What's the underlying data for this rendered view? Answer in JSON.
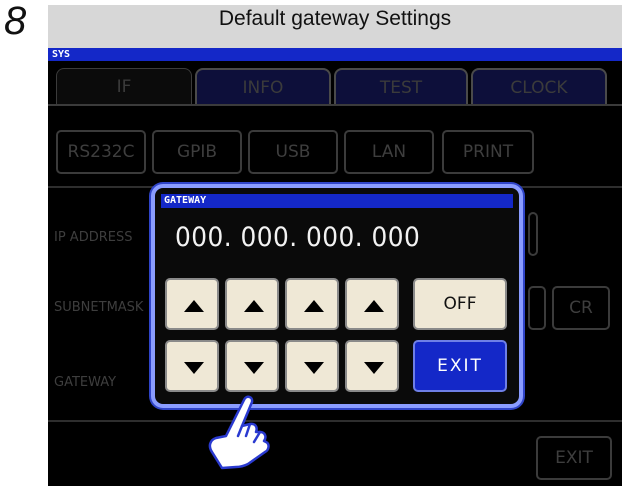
{
  "step_number": "8",
  "title": "Default gateway Settings",
  "header": {
    "label": "SYS"
  },
  "tabs": [
    {
      "label": "IF",
      "active": true
    },
    {
      "label": "INFO",
      "active": false
    },
    {
      "label": "TEST",
      "active": false
    },
    {
      "label": "CLOCK",
      "active": false
    }
  ],
  "interfaces": [
    "RS232C",
    "GPIB",
    "USB",
    "LAN",
    "PRINT"
  ],
  "settings": {
    "ip_address_label": "IP ADDRESS",
    "subnetmask_label": "SUBNETMASK",
    "gateway_label": "GATEWAY",
    "cr_label": "CR"
  },
  "dialog": {
    "title": "GATEWAY",
    "value": "000. 000. 000. 000",
    "off_label": "OFF",
    "exit_label": "EXIT"
  },
  "footer": {
    "exit_label": "EXIT"
  },
  "colors": {
    "accent_blue": "#1428c8",
    "dialog_border": "#8a9cff",
    "key_face": "#efe8d6"
  },
  "icons": {
    "up": "triangle-up-icon",
    "down": "triangle-down-icon",
    "pointer": "pointing-hand-icon"
  }
}
